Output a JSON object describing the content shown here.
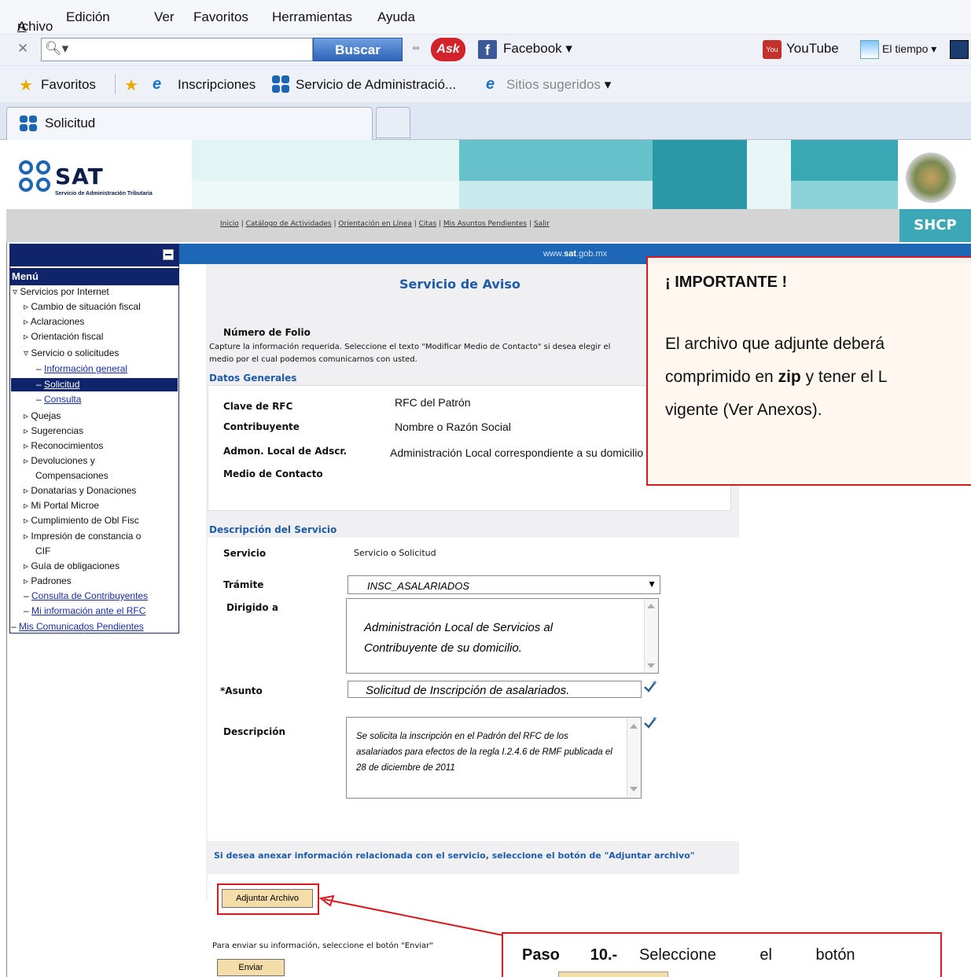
{
  "browser": {
    "menu": [
      "Archivo",
      "Edición",
      "Ver",
      "Favoritos",
      "Herramientas",
      "Ayuda"
    ],
    "search_button": "Buscar",
    "ask_label": "Ask",
    "facebook_label": "Facebook",
    "youtube_label": "YouTube",
    "weather_label": "El tiempo",
    "favorites_label": "Favoritos",
    "fav_items": [
      "Inscripciones",
      "Servicio de Administració...",
      "Sitios sugeridos"
    ],
    "tab_label": "Solicitud"
  },
  "site": {
    "logo_text": "SAT",
    "logo_subtitle": "Servicio de Administración Tributaria",
    "nav_links": [
      "Inicio",
      "Catálogo de Actividades",
      "Orientación en Línea",
      "Citas",
      "Mis Asuntos Pendientes",
      "Salir"
    ],
    "shcp": "SHCP",
    "url_prefix": "www.",
    "url_bold": "sat",
    "url_suffix": ".gob.mx"
  },
  "sidebar": {
    "menu_title": "Menú",
    "items": [
      "Servicios por Internet",
      "Cambio de situación fiscal",
      "Aclaraciones",
      "Orientación fiscal",
      "Servicio o solicitudes",
      "Información general",
      "Solicitud",
      "Consulta",
      "Quejas",
      "Sugerencias",
      "Reconocimientos",
      "Devoluciones y",
      "Compensaciones",
      "Donatarias y Donaciones",
      "Mi Portal Microe",
      "Cumplimiento de Obl Fisc",
      "Impresión de constancia o",
      "CIF",
      "Guía de obligaciones",
      "Padrones",
      "Consulta de Contribuyentes",
      "Mi información ante el RFC",
      "Mis Comunicados Pendientes"
    ]
  },
  "main": {
    "title": "Servicio de Aviso",
    "folio_label": "Número de Folio",
    "instructions_1": "Capture la información requerida. Seleccione el texto \"Modificar Medio de Contacto\" si desea elegir el",
    "instructions_2": "medio por el cual podemos comunicarnos con usted.",
    "datos_generales": "Datos Generales",
    "rfc_label": "Clave de RFC",
    "rfc_value": "RFC del Patrón",
    "contrib_label": "Contribuyente",
    "contrib_value": "Nombre o Razón Social",
    "admon_label": "Admon. Local de Adscr.",
    "admon_value": "Administración Local  correspondiente a su domicilio",
    "medio_label": "Medio de Contacto",
    "descripcion_servicio": "Descripción del Servicio",
    "servicio_label": "Servicio",
    "servicio_value": "Servicio o Solicitud",
    "tramite_label": "Trámite",
    "tramite_value": "INSC_ASALARIADOS",
    "dirigido_label": "Dirigido a",
    "dirigido_value": "Administración  Local  de  Servicios  al Contribuyente de su domicilio.",
    "asunto_label": "*Asunto",
    "asunto_value": "Solicitud de Inscripción de asalariados.",
    "descripcion_label": "Descripción",
    "descripcion_value": "Se solicita la inscripción en el Padrón del RFC de los asalariados para efectos de la regla I.2.4.6 de RMF publicada el 28 de diciembre de 2011",
    "anexar_text": "Si desea anexar información relacionada con el servicio, seleccione el botón de \"Adjuntar archivo\"",
    "adjuntar_button": "Adjuntar Archivo",
    "enviar_text": "Para enviar su información, seleccione el botón \"Enviar\"",
    "enviar_button": "Enviar"
  },
  "callouts": {
    "important_title": "¡ IMPORTANTE !",
    "important_line1": "El archivo que adjunte deberá",
    "important_line2_pre": "comprimido en ",
    "important_line2_bold": "zip",
    "important_line2_post": " y tener el L",
    "important_line3": "vigente (Ver Anexos).",
    "paso_bold": "Paso       10.-",
    "paso_text": "Seleccione          el          botón"
  },
  "colors": {
    "accent_red": "#d71920",
    "sat_blue": "#1e66b6",
    "menu_navy": "#10246b",
    "banner_teal": "#3da8b5"
  }
}
